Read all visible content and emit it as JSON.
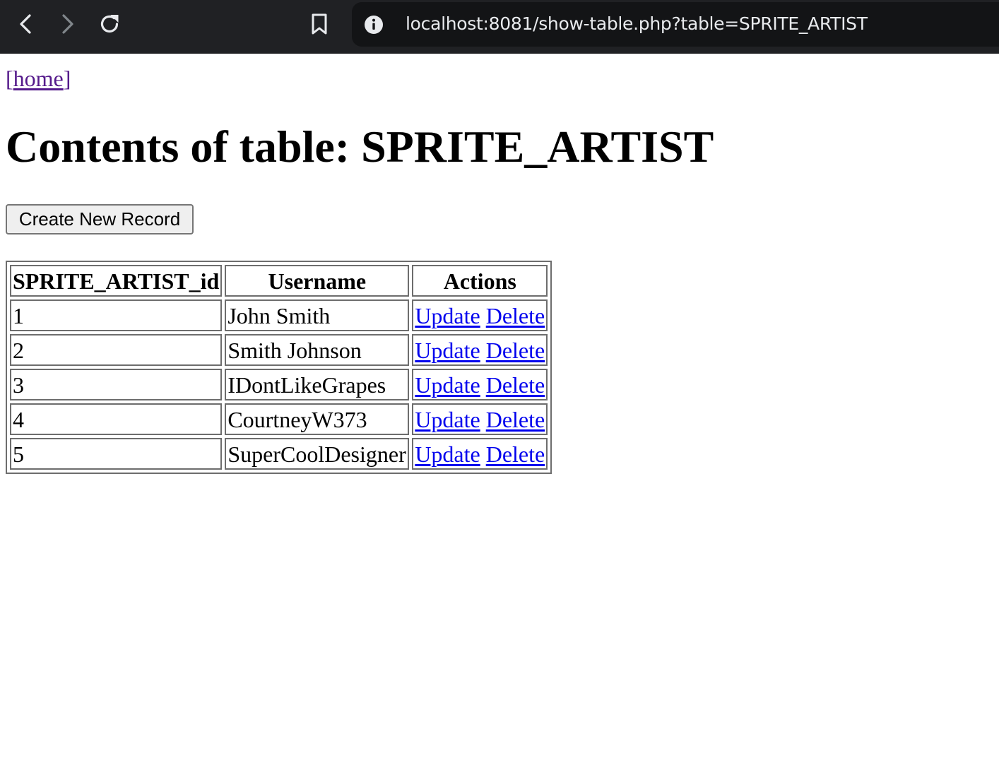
{
  "browser": {
    "url": "localhost:8081/show-table.php?table=SPRITE_ARTIST"
  },
  "nav": {
    "open_bracket": "[",
    "home_label": "home",
    "close_bracket": "]"
  },
  "page": {
    "title": "Contents of table: SPRITE_ARTIST",
    "create_button_label": "Create New Record"
  },
  "table": {
    "columns": [
      "SPRITE_ARTIST_id",
      "Username",
      "Actions"
    ],
    "rows": [
      {
        "id": "1",
        "username": "John Smith",
        "update": "Update",
        "delete": "Delete"
      },
      {
        "id": "2",
        "username": "Smith Johnson",
        "update": "Update",
        "delete": "Delete"
      },
      {
        "id": "3",
        "username": "IDontLikeGrapes",
        "update": "Update",
        "delete": "Delete"
      },
      {
        "id": "4",
        "username": "CourtneyW373",
        "update": "Update",
        "delete": "Delete"
      },
      {
        "id": "5",
        "username": "SuperCoolDesigner",
        "update": "Update",
        "delete": "Delete"
      }
    ]
  },
  "colors": {
    "toolbar_bg": "#202124",
    "omnibox_bg": "#131416",
    "link": "#0000ee",
    "visited_link": "#551a8b"
  },
  "icons": [
    "back-arrow-icon",
    "forward-arrow-icon",
    "reload-icon",
    "bookmark-icon",
    "site-info-icon"
  ]
}
